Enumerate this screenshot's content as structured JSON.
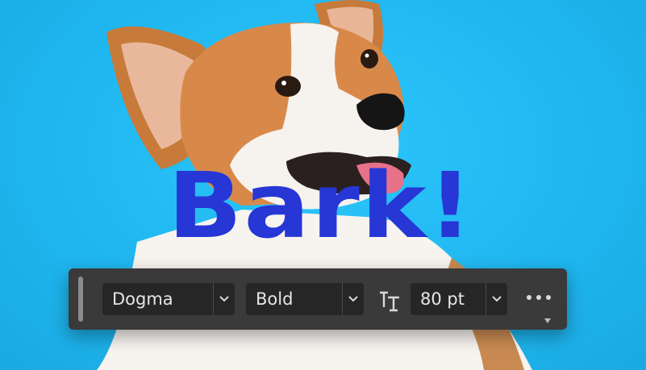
{
  "canvas": {
    "background_color": "#22b8f0",
    "text_layer": {
      "text": "Bark!",
      "color": "#2637d6"
    }
  },
  "toolbar": {
    "font_family": {
      "value": "Dogma",
      "icon": "chevron-down-icon"
    },
    "font_style": {
      "value": "Bold",
      "icon": "chevron-down-icon"
    },
    "font_size": {
      "icon": "text-size-icon",
      "value": "80 pt"
    },
    "more": {
      "icon": "more-options-icon"
    }
  }
}
